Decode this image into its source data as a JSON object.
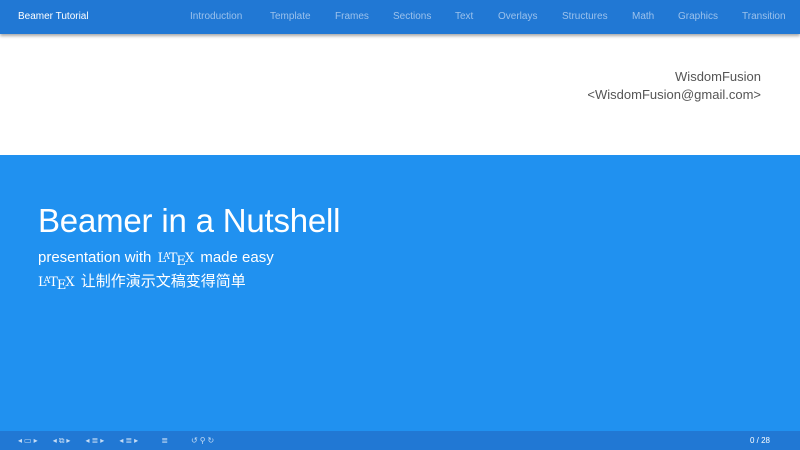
{
  "header": {
    "brand": "Beamer Tutorial",
    "nav": [
      "Introduction",
      "Template",
      "Frames",
      "Sections",
      "Text",
      "Overlays",
      "Structures",
      "Math",
      "Graphics",
      "Transition"
    ]
  },
  "author": {
    "name": "WisdomFusion",
    "email": "<WisdomFusion@gmail.com>"
  },
  "title_slide": {
    "title": "Beamer in a Nutshell",
    "subtitle1_before": "presentation with",
    "subtitle1_after": "made easy",
    "subtitle2_after": "让制作演示文稿变得简单",
    "latex_logo": "LaTeX"
  },
  "footer": {
    "page": "0 / 28"
  },
  "colors": {
    "header_bg": "#2178d4",
    "hero_bg": "#2091f0",
    "nav_text": "#9cc2ec"
  }
}
